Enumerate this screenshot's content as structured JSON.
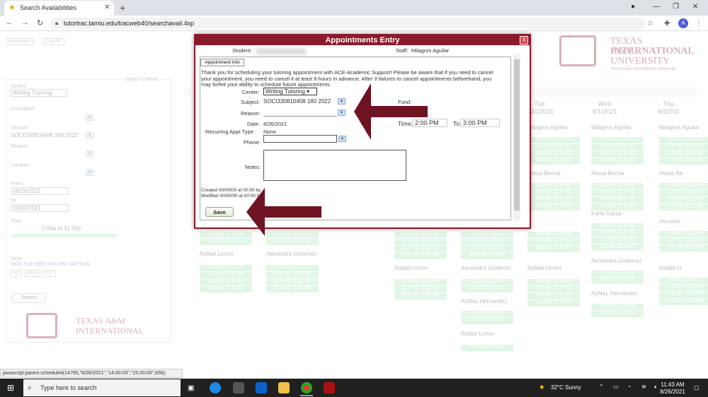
{
  "browser": {
    "tab_title": "Search Availabilities",
    "url": "tutortrac.tamiu.edu/tracweb40/searchavail.4sp",
    "avatar_letter": "A"
  },
  "page": {
    "top_buttons": [
      "Main Menu",
      "Log Off"
    ],
    "search_criteria_label": "Search Criteria",
    "logo": {
      "line1": "TEXAS A&M",
      "line2": "INTERNATIONAL",
      "line3": "UNIVERSITY",
      "subtitle": "Texas A&M International University"
    },
    "left_panel": {
      "center_label": "Center:",
      "center_value": "Writing Tutoring",
      "consultant_label": "Consultant:",
      "section_label": "Section:",
      "section_value": "SOCI330810408 180 2022",
      "reason_label": "Reason:",
      "location_label": "Location:",
      "from_label": "From:",
      "from_value": "08/26/2021",
      "to_label": "To:",
      "to_value": "09/02/2021",
      "time_label": "Time:",
      "time_value": "0.00a to 11.59p",
      "days_label": "Days:",
      "days": "MON TUE WED THU FRI SAT SUN",
      "day_buttons": [
        "All",
        "None",
        "M-F"
      ],
      "search_button": "Search"
    },
    "calendar": {
      "headers": [
        {
          "day": "Tue",
          "date": "8/31/2021"
        },
        {
          "day": "Wed",
          "date": "9/1/2021"
        },
        {
          "day": "Thu",
          "date": "9/2/202"
        }
      ],
      "names": [
        "Rafael Limon",
        "Alexandra Gutierrez",
        "Rafael Limon",
        "Alexandra Gutierrez",
        "Rafael Limon",
        "Milagros Aguilar",
        "Milagros Aguilar",
        "Milagros Aguilar",
        "Alissa Bernal",
        "Alissa Bernal",
        "Alissa Be",
        "Karla Garza",
        "Alexandra Gutierrez",
        "Alexand",
        "Ashley Hernandez",
        "Ashley Hernandez",
        "Rafael Limon",
        "Rafael Li"
      ],
      "slot_text": "4:00 PM - 5:00 PM"
    }
  },
  "modal": {
    "title": "Appointments Entry",
    "close_label": "X",
    "student_label": "Student:",
    "staff_label": "Staff:",
    "staff_value": "Milagros Aguilar",
    "tab_label": "Appointment Info",
    "message": "Thank you for scheduling your tutoring appointment with ACE-Academic Support! Please be aware that if you need to cancel your appointment, you need to cancel it at least 8 hours in advance. After 3 failures to cancel appointments beforehand, you may forfeit your ability to schedule future appointments.",
    "center_label": "Center:",
    "center_value": "Writing Tutoring",
    "subject_label": "Subject:",
    "subject_value": "SOCI330810408 180 2022",
    "fund_label": "Fund:",
    "reason_label": "Reason:",
    "date_label": "Date:",
    "date_value": "8/26/2021",
    "time_label": "Time:",
    "time_value": "2:00 PM",
    "to_label": "To:",
    "to_value": "3:00 PM",
    "recurring_label": "Recurring Appt Type:",
    "recurring_value": "None",
    "phone_label": "Phone:",
    "notes_label": "Notes:",
    "created_text": "Created 00/00/00 at 00:00 by",
    "modified_text": "Modified 00/00/00 at 00:00 by",
    "save_label": "Save"
  },
  "status_bar": "javascript:parent.scheduleit(14765,\"8/26/2021\",\"14:00:00\",\"15:00:00\",658);",
  "taskbar": {
    "search_placeholder": "Type here to search",
    "weather": "32°C  Sunny",
    "time": "11:43 AM",
    "date": "8/26/2021"
  },
  "colors": {
    "accent": "#8b1a2c",
    "slot_green": "#a6e6b3",
    "arrow": "#6e1423"
  }
}
